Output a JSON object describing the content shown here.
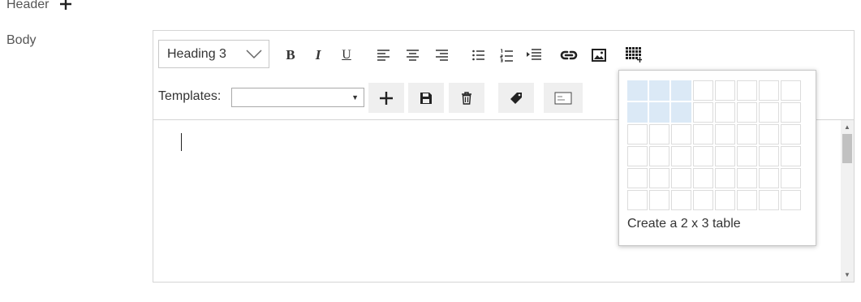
{
  "form": {
    "header_label": "Header",
    "body_label": "Body"
  },
  "toolbar": {
    "heading_select_value": "Heading 3",
    "bold_label": "B",
    "italic_label": "I",
    "underline_label": "U",
    "templates_label": "Templates:",
    "templates_value": ""
  },
  "icons": {
    "header_add": "plus-icon",
    "align_left": "align-left-icon",
    "align_center": "align-center-icon",
    "align_right": "align-right-icon",
    "bulleted_list": "bulleted-list-icon",
    "numbered_list": "numbered-list-icon",
    "indent": "indent-icon",
    "link": "link-icon",
    "image": "image-icon",
    "table": "table-icon",
    "add_template": "plus-icon",
    "save_template": "save-icon",
    "delete_template": "trash-icon",
    "tag": "tag-icon",
    "text_field": "text-field-icon"
  },
  "table_picker": {
    "rows": 6,
    "cols": 8,
    "selected_rows": 2,
    "selected_cols": 3,
    "caption": "Create a 2 x 3 table"
  },
  "colors": {
    "selected_cell": "#dbe9f6",
    "border": "#d5d5d5",
    "button_bg": "#efefef"
  }
}
